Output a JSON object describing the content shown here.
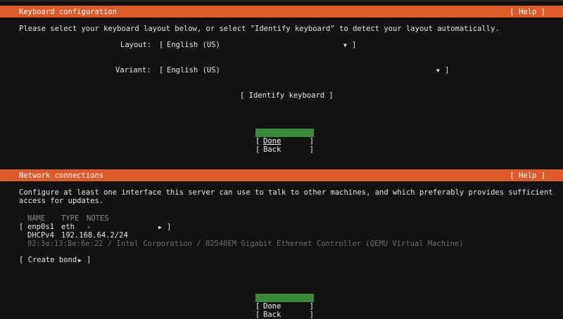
{
  "keyboard": {
    "title": "Keyboard configuration",
    "help": "[ Help ]",
    "intro": "Please select your keyboard layout below, or select \"Identify keyboard\" to detect your layout automatically.",
    "layout_label": "Layout:",
    "layout_value": "English (US)",
    "variant_label": "Variant:",
    "variant_value": "English (US)",
    "identify_button": "[ Identify keyboard ]",
    "done": "Done",
    "back": "Back"
  },
  "network": {
    "title": "Network connections",
    "help": "[ Help ]",
    "intro_line1": "Configure at least one interface this server can use to talk to other machines, and which preferably provides sufficient",
    "intro_line2": "access for updates.",
    "columns": {
      "name": "NAME",
      "type": "TYPE",
      "notes": "NOTES"
    },
    "interface": {
      "name": "enp0s1",
      "type": "eth",
      "notes": "-",
      "dhcp_label": "DHCPv4",
      "dhcp_value": "192.168.64.2/24",
      "hw_info": "02:3e:13:8e:6e:22 / Intel Corporation / 82540EM Gigabit Ethernet Controller (QEMU Virtual Machine)"
    },
    "create_bond": "[ Create bond ",
    "done": "Done",
    "back": "Back"
  },
  "colors": {
    "header": "#dd5a2a",
    "selected": "#3b8a3a",
    "background": "#121212"
  }
}
